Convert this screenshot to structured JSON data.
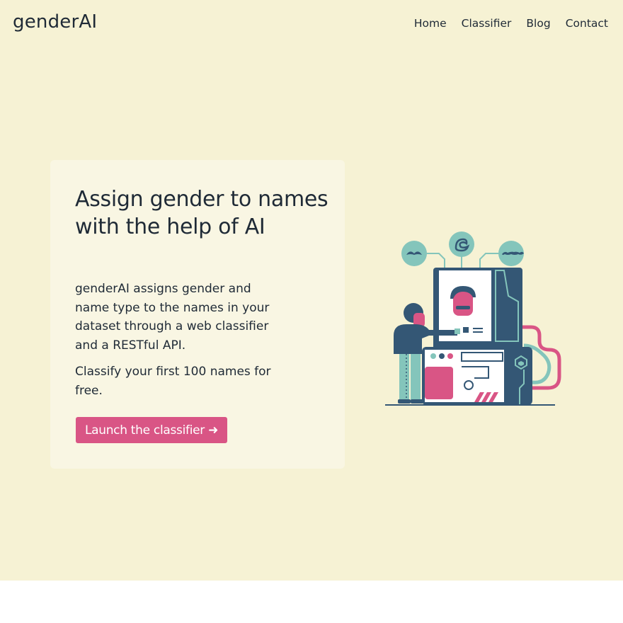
{
  "nav": {
    "brand": "genderAI",
    "links": [
      "Home",
      "Classifier",
      "Blog",
      "Contact"
    ]
  },
  "hero": {
    "headline": "Assign gender to names with the help of AI",
    "description": "genderAI assigns gender and name type to the names in your dataset through a web classifier and a RESTful API.",
    "offer": "Classify your first 100 names for free.",
    "cta_label": "Launch the classifier ➜"
  },
  "colors": {
    "background": "#f6f2d4",
    "card": "#f9f6e3",
    "accent": "#d95585",
    "text": "#1f2a36",
    "navy": "#345775",
    "teal": "#84c5bb"
  }
}
